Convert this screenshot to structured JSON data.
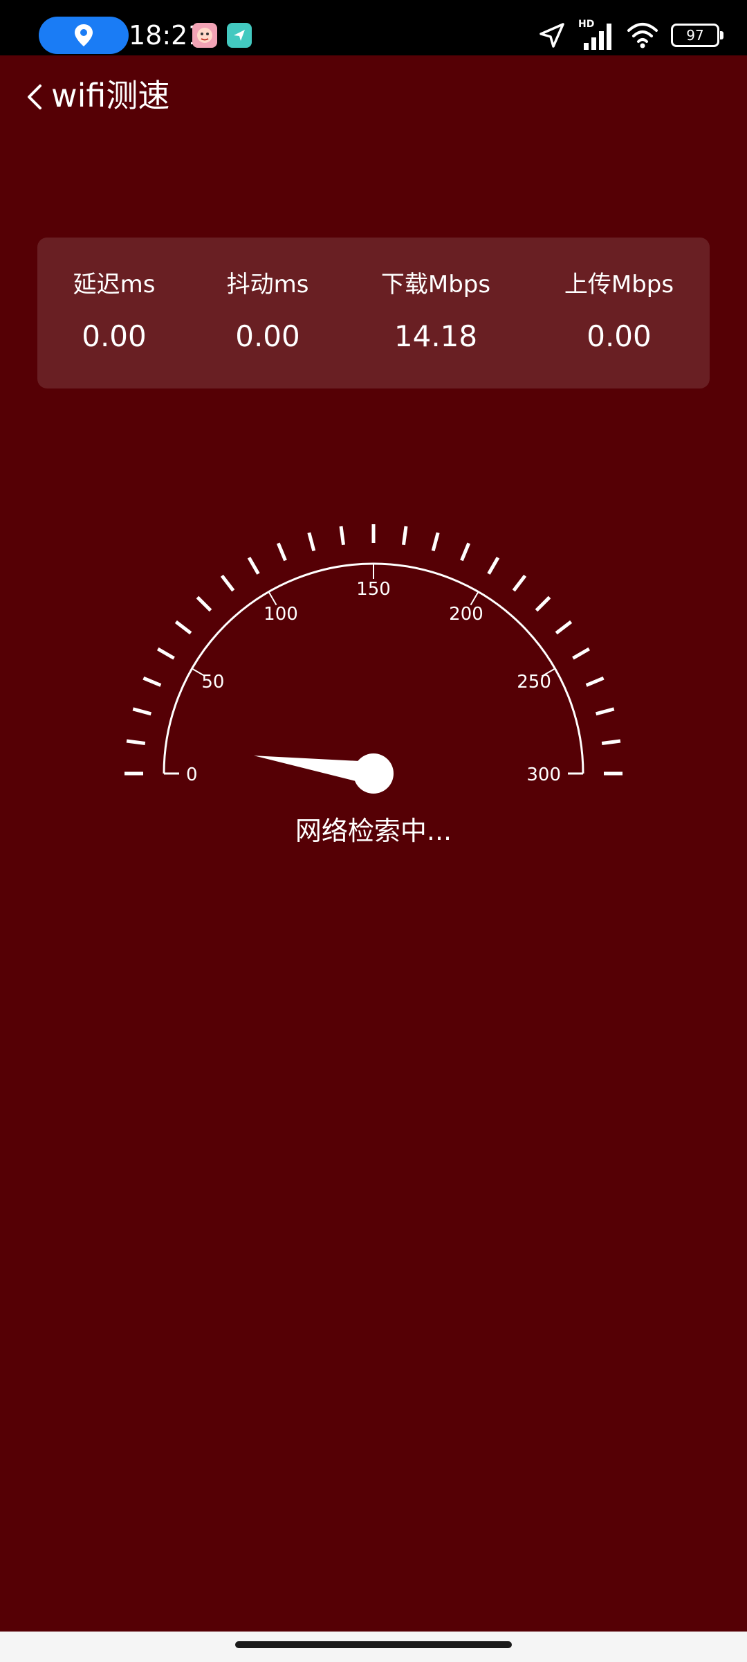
{
  "status_bar": {
    "time": "18:21",
    "network_label": "HD",
    "battery": "97"
  },
  "app_bar": {
    "title": "wifi测速"
  },
  "metrics": [
    {
      "label": "延迟ms",
      "value": "0.00"
    },
    {
      "label": "抖动ms",
      "value": "0.00"
    },
    {
      "label": "下载Mbps",
      "value": "14.18"
    },
    {
      "label": "上传Mbps",
      "value": "0.00"
    }
  ],
  "gauge": {
    "min": 0,
    "max": 300,
    "needle_value": 14.18,
    "tick_labels": [
      "0",
      "50",
      "100",
      "150",
      "200",
      "250",
      "300"
    ],
    "status": "网络检索中..."
  },
  "colors": {
    "background": "#550005",
    "status_bar": "#000000",
    "location_pill": "#1a7cf5"
  },
  "icons": {
    "location": "location-pin-icon",
    "back": "chevron-left-icon",
    "navigation": "navigation-arrow-icon",
    "signal": "signal-bars-icon",
    "wifi": "wifi-icon",
    "battery": "battery-icon"
  }
}
